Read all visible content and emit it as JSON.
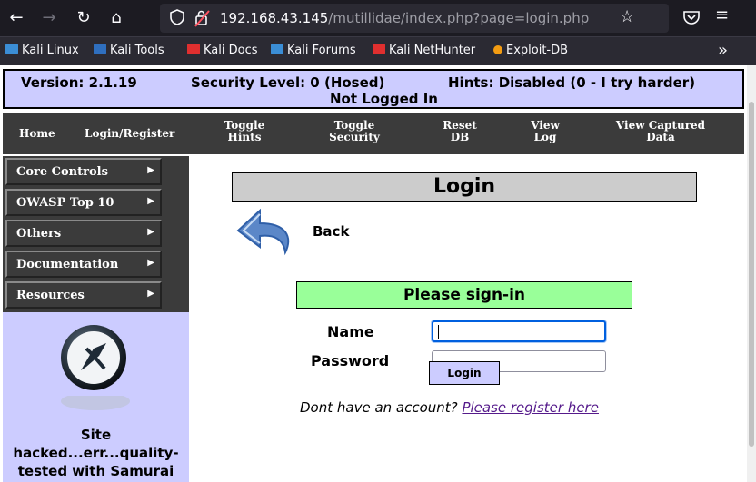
{
  "browser": {
    "url_host": "192.168.43.145",
    "url_path": "/mutillidae/index.php?page=login.php",
    "bookmarks": [
      {
        "label": "Kali Linux",
        "color": "#3b8ed6"
      },
      {
        "label": "Kali Tools",
        "color": "#e84c3d"
      },
      {
        "label": "Kali Docs",
        "color": "#e02f2f"
      },
      {
        "label": "Kali Forums",
        "color": "#3b8ed6"
      },
      {
        "label": "Kali NetHunter",
        "color": "#e02f2f"
      },
      {
        "label": "Exploit-DB",
        "color": "#f39c12"
      }
    ],
    "icons": [
      "back-arrow",
      "forward-arrow",
      "reload",
      "home",
      "shield",
      "lock-warning",
      "star",
      "pocket",
      "menu",
      "overflow-chevron"
    ]
  },
  "status": {
    "version": "Version: 2.1.19",
    "security_level": "Security Level: 0 (Hosed)",
    "hints": "Hints: Disabled (0 - I try harder)",
    "login_state": "Not Logged In"
  },
  "menu": {
    "home": "Home",
    "login_register": "Login/Register",
    "toggle_hints": [
      "Toggle",
      "Hints"
    ],
    "toggle_security": [
      "Toggle",
      "Security"
    ],
    "reset_db": [
      "Reset",
      "DB"
    ],
    "view_log": [
      "View",
      "Log"
    ],
    "view_captured": [
      "View Captured",
      "Data"
    ]
  },
  "sidebar": {
    "items": [
      {
        "label": "Core Controls"
      },
      {
        "label": "OWASP Top 10"
      },
      {
        "label": "Others"
      },
      {
        "label": "Documentation"
      },
      {
        "label": "Resources"
      }
    ],
    "tagline": [
      "Site",
      "hacked...err...quality-",
      "tested with Samurai"
    ]
  },
  "login": {
    "title": "Login",
    "back_label": "Back",
    "signin_title": "Please sign-in",
    "name_label": "Name",
    "password_label": "Password",
    "name_value": "",
    "password_value": "",
    "button_label": "Login",
    "register_prompt": "Dont have an account?",
    "register_link": "Please register here"
  },
  "colors": {
    "status_bg": "#ccccff",
    "menu_bg": "#3b3b3b",
    "signin_bg": "#99ff99",
    "title_bg": "#cccccc",
    "link": "#551a8b"
  }
}
